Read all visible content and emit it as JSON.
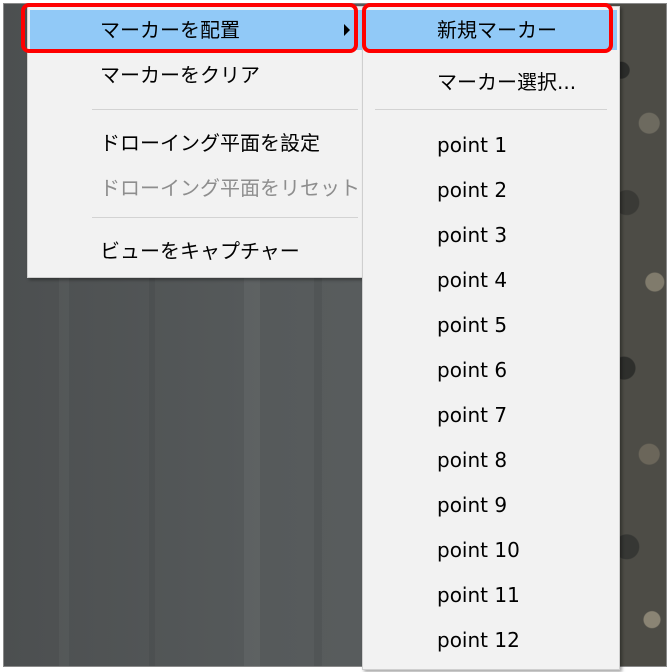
{
  "main_menu": {
    "items": [
      {
        "label": "マーカーを配置",
        "state": "highlighted",
        "has_submenu": true
      },
      {
        "label": "マーカーをクリア",
        "state": "normal"
      },
      {
        "label": "ドローイング平面を設定",
        "state": "normal"
      },
      {
        "label": "ドローイング平面をリセット",
        "state": "disabled"
      },
      {
        "label": "ビューをキャプチャー",
        "state": "normal"
      }
    ]
  },
  "sub_menu": {
    "items": [
      {
        "label": "新規マーカー",
        "state": "highlighted"
      },
      {
        "label": "マーカー選択...",
        "state": "normal"
      },
      {
        "label": "point 1"
      },
      {
        "label": "point 2"
      },
      {
        "label": "point 3"
      },
      {
        "label": "point 4"
      },
      {
        "label": "point 5"
      },
      {
        "label": "point 6"
      },
      {
        "label": "point 7"
      },
      {
        "label": "point 8"
      },
      {
        "label": "point 9"
      },
      {
        "label": "point 10"
      },
      {
        "label": "point 11"
      },
      {
        "label": "point 12"
      }
    ]
  },
  "colors": {
    "highlight": "#91c9f7",
    "callout": "#ff0000",
    "menu_bg": "#f2f2f2",
    "disabled_text": "#8e8e8e"
  },
  "icons": {
    "submenu_arrow": "chevron-right-icon"
  }
}
